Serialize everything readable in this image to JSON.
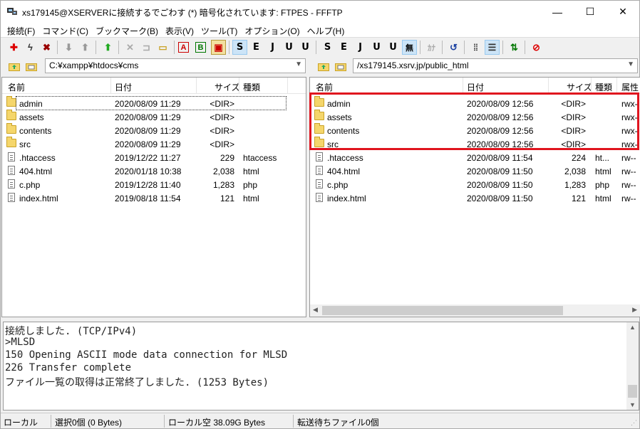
{
  "window": {
    "title": "xs179145@XSERVERに接続するでごわす (*) 暗号化されています: FTPES - FFFTP",
    "minimize": "—",
    "maximize": "☐",
    "close": "✕"
  },
  "menu": [
    "接続(F)",
    "コマンド(C)",
    "ブックマーク(B)",
    "表示(V)",
    "ツール(T)",
    "オプション(O)",
    "ヘルプ(H)"
  ],
  "toolbar": {
    "buttons": [
      "connect-icon",
      "quick-connect-icon",
      "disconnect-icon",
      "download-icon",
      "upload-icon",
      "mirror-upload-icon",
      "delete-icon",
      "rename-icon",
      "mkdir-icon",
      "ascii-mode-icon",
      "binary-mode-icon",
      "auto-mode-icon",
      "sjis-icon",
      "euc-icon",
      "jis-icon",
      "utf8-icon",
      "utf8bom-icon",
      "host-sjis-icon",
      "host-euc-icon",
      "host-jis-icon",
      "host-utf8-icon",
      "host-utf8bom-icon",
      "no-convert-icon",
      "kana-icon",
      "refresh-icon",
      "list-view-icon",
      "detail-view-icon",
      "sync-icon",
      "stop-icon"
    ],
    "labels": {
      "A": "A",
      "B": "B",
      "S": "S",
      "E": "E",
      "J": "J",
      "U": "U",
      "mu": "無",
      "ka": "ｶﾅ"
    }
  },
  "local": {
    "path": "C:¥xampp¥htdocs¥cms",
    "columns": [
      "名前",
      "日付",
      "サイズ",
      "種類"
    ],
    "files": [
      {
        "name": "admin",
        "date": "2020/08/09 11:29",
        "size": "<DIR>",
        "type": "",
        "dir": true
      },
      {
        "name": "assets",
        "date": "2020/08/09 11:29",
        "size": "<DIR>",
        "type": "",
        "dir": true
      },
      {
        "name": "contents",
        "date": "2020/08/09 11:29",
        "size": "<DIR>",
        "type": "",
        "dir": true
      },
      {
        "name": "src",
        "date": "2020/08/09 11:29",
        "size": "<DIR>",
        "type": "",
        "dir": true
      },
      {
        "name": ".htaccess",
        "date": "2019/12/22 11:27",
        "size": "229",
        "type": "htaccess",
        "dir": false
      },
      {
        "name": "404.html",
        "date": "2020/01/18 10:38",
        "size": "2,038",
        "type": "html",
        "dir": false
      },
      {
        "name": "c.php",
        "date": "2019/12/28 11:40",
        "size": "1,283",
        "type": "php",
        "dir": false
      },
      {
        "name": "index.html",
        "date": "2019/08/18 11:54",
        "size": "121",
        "type": "html",
        "dir": false
      }
    ]
  },
  "remote": {
    "path": "/xs179145.xsrv.jp/public_html",
    "columns": [
      "名前",
      "日付",
      "サイズ",
      "種類",
      "属性"
    ],
    "files": [
      {
        "name": "admin",
        "date": "2020/08/09 12:56",
        "size": "<DIR>",
        "type": "",
        "attr": "rwx-",
        "dir": true
      },
      {
        "name": "assets",
        "date": "2020/08/09 12:56",
        "size": "<DIR>",
        "type": "",
        "attr": "rwx-",
        "dir": true
      },
      {
        "name": "contents",
        "date": "2020/08/09 12:56",
        "size": "<DIR>",
        "type": "",
        "attr": "rwx-",
        "dir": true
      },
      {
        "name": "src",
        "date": "2020/08/09 12:56",
        "size": "<DIR>",
        "type": "",
        "attr": "rwx-",
        "dir": true
      },
      {
        "name": ".htaccess",
        "date": "2020/08/09 11:54",
        "size": "224",
        "type": "ht...",
        "attr": "rw--",
        "dir": false
      },
      {
        "name": "404.html",
        "date": "2020/08/09 11:50",
        "size": "2,038",
        "type": "html",
        "attr": "rw--",
        "dir": false
      },
      {
        "name": "c.php",
        "date": "2020/08/09 11:50",
        "size": "1,283",
        "type": "php",
        "attr": "rw--",
        "dir": false
      },
      {
        "name": "index.html",
        "date": "2020/08/09 11:50",
        "size": "121",
        "type": "html",
        "attr": "rw--",
        "dir": false
      }
    ]
  },
  "log": [
    "接続しました. (TCP/IPv4)",
    ">MLSD",
    "150 Opening ASCII mode data connection for MLSD",
    "226 Transfer complete",
    "ファイル一覧の取得は正常終了しました. (1253 Bytes)"
  ],
  "status": {
    "mode": "ローカル",
    "selection": "選択0個 (0 Bytes)",
    "free": "ローカル空 38.09G Bytes",
    "queue": "転送待ちファイル0個"
  },
  "colors": {
    "highlight": "#e0141e",
    "folder": "#f5d66b"
  }
}
